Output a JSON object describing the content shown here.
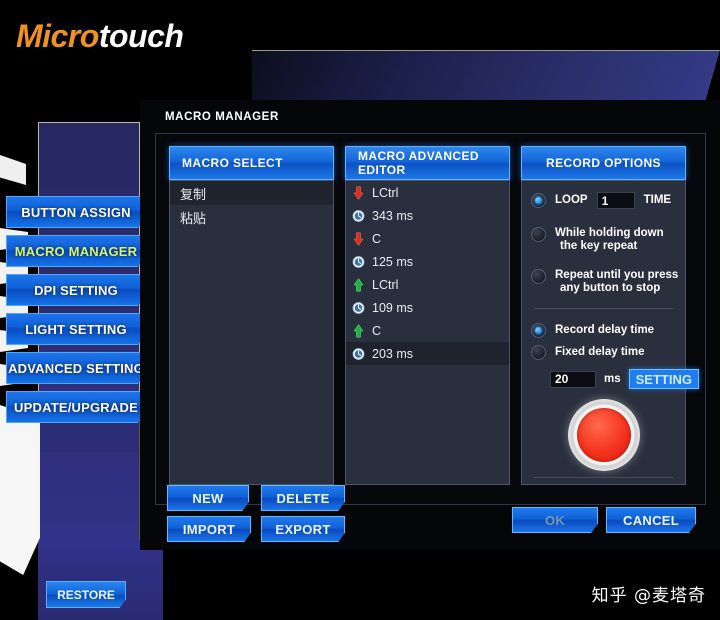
{
  "brand": {
    "part1": "Micro",
    "part2": "touch",
    "accent": "#f2921c"
  },
  "sidebar": {
    "items": [
      {
        "label": "BUTTON ASSIGN",
        "active": false
      },
      {
        "label": "MACRO MANAGER",
        "active": true
      },
      {
        "label": "DPI SETTING",
        "active": false
      },
      {
        "label": "LIGHT SETTING",
        "active": false
      },
      {
        "label": "ADVANCED SETTING",
        "active": false
      },
      {
        "label": "UPDATE/UPGRADE",
        "active": false
      }
    ],
    "restore_label": "RESTORE",
    "active_color": "#d8f46a"
  },
  "dialog": {
    "title": "MACRO MANAGER",
    "macro_select": {
      "header": "MACRO SELECT",
      "items": [
        {
          "label": "复制",
          "selected": true
        },
        {
          "label": "粘贴",
          "selected": false
        }
      ]
    },
    "macro_editor": {
      "header": "MACRO ADVANCED EDITOR",
      "rows": [
        {
          "icon": "key-down-icon",
          "label": "LCtrl",
          "selected": false
        },
        {
          "icon": "clock-icon",
          "label": "343 ms",
          "selected": false
        },
        {
          "icon": "key-down-icon",
          "label": "C",
          "selected": false
        },
        {
          "icon": "clock-icon",
          "label": "125 ms",
          "selected": false
        },
        {
          "icon": "key-up-icon",
          "label": "LCtrl",
          "selected": false
        },
        {
          "icon": "clock-icon",
          "label": "109 ms",
          "selected": false
        },
        {
          "icon": "key-up-icon",
          "label": "C",
          "selected": false
        },
        {
          "icon": "clock-icon",
          "label": "203 ms",
          "selected": true
        }
      ]
    },
    "record_options": {
      "header": "RECORD OPTIONS",
      "loop": {
        "prefix_label": "LOOP",
        "suffix_label": "TIME",
        "value": "1",
        "selected": true
      },
      "hold_repeat": {
        "line1": "While holding down",
        "line2": "the key repeat",
        "selected": false
      },
      "until_press": {
        "line1": "Repeat until you press",
        "line2": "any  button to stop",
        "selected": false
      },
      "record_delay": {
        "label": "Record delay time",
        "selected": true
      },
      "fixed_delay": {
        "label": "Fixed delay time",
        "selected": false
      },
      "delay_value": "20",
      "delay_unit": "ms",
      "setting_label": "SETTING",
      "record_button_name": "record-button"
    },
    "actions": {
      "new": "NEW",
      "delete": "DELETE",
      "import": "IMPORT",
      "export": "EXPORT",
      "ok": "OK",
      "cancel": "CANCEL"
    }
  },
  "watermark": "知乎 @麦塔奇"
}
